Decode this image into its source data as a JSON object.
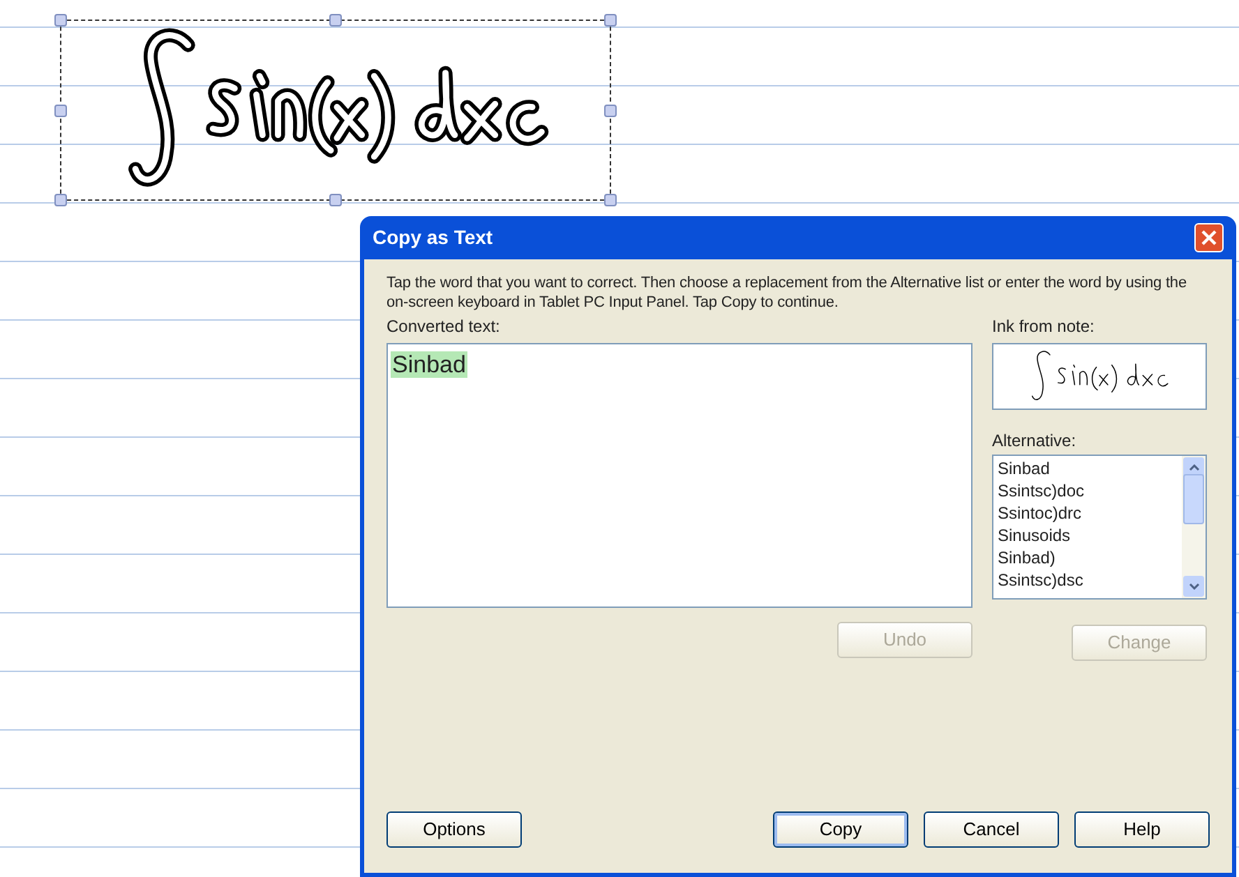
{
  "dialog": {
    "title": "Copy as Text",
    "instructions": "Tap the word that you want to correct. Then choose a replacement from the Alternative list or enter the word by using the on-screen keyboard in Tablet PC Input Panel. Tap Copy to continue.",
    "converted_label": "Converted text:",
    "converted_words": [
      {
        "text": "Sinbad",
        "selected": true
      }
    ],
    "ink_label": "Ink from note:",
    "alternative_label": "Alternative:",
    "alternatives": [
      "Sinbad",
      "Ssintsc)doc",
      "Ssintoc)drc",
      "Sinusoids",
      "Sinbad)",
      "Ssintsc)dsc"
    ],
    "undo_button": {
      "label": "Undo",
      "disabled": true
    },
    "change_button": {
      "label": "Change",
      "disabled": true
    },
    "footer_buttons": [
      {
        "label": "Options",
        "disabled": false,
        "default": false
      },
      {
        "label": "Copy",
        "disabled": false,
        "default": true
      },
      {
        "label": "Cancel",
        "disabled": false,
        "default": false
      },
      {
        "label": "Help",
        "disabled": false,
        "default": false
      }
    ]
  }
}
